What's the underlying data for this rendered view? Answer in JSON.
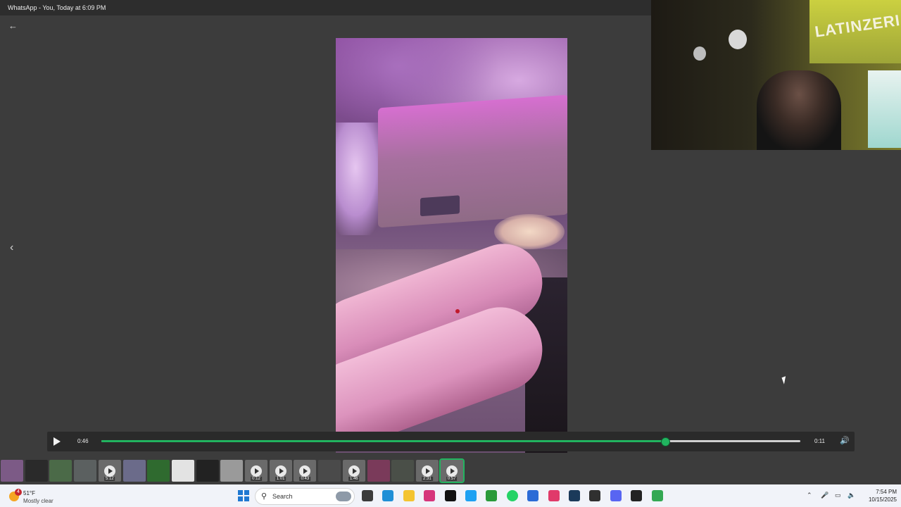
{
  "window": {
    "title": "WhatsApp - You, Today at 6:09 PM"
  },
  "player": {
    "current_time": "0:46",
    "remaining_time": "0:11",
    "progress": 0.807
  },
  "webcam": {
    "wall_text": "LATINZERIAN"
  },
  "thumbnails": [
    {
      "duration": "",
      "color": "#7c5a86",
      "type": "image"
    },
    {
      "duration": "",
      "color": "#2a2a2a",
      "type": "image"
    },
    {
      "duration": "",
      "color": "#4b6a48",
      "type": "image"
    },
    {
      "duration": "",
      "color": "#5b6060",
      "type": "image"
    },
    {
      "duration": "5:12",
      "color": "#6a6a6a",
      "type": "video"
    },
    {
      "duration": "",
      "color": "#6b6b8a",
      "type": "image"
    },
    {
      "duration": "",
      "color": "#2f6a2f",
      "type": "image"
    },
    {
      "duration": "",
      "color": "#e3e3e3",
      "type": "image"
    },
    {
      "duration": "",
      "color": "#222222",
      "type": "image"
    },
    {
      "duration": "",
      "color": "#9a9a9a",
      "type": "image"
    },
    {
      "duration": "0:12",
      "color": "#6a6a6a",
      "type": "video"
    },
    {
      "duration": "1:01",
      "color": "#6a6a6a",
      "type": "video"
    },
    {
      "duration": "0:43",
      "color": "#6a6a6a",
      "type": "video"
    },
    {
      "duration": "",
      "color": "#4a4a4a",
      "type": "image"
    },
    {
      "duration": "1:46",
      "color": "#6a6a6a",
      "type": "video"
    },
    {
      "duration": "",
      "color": "#7a3a5a",
      "type": "image"
    },
    {
      "duration": "",
      "color": "#4a4f48",
      "type": "image"
    },
    {
      "duration": "2:31",
      "color": "#6a6a6a",
      "type": "video"
    },
    {
      "duration": "0:57",
      "color": "#6a6a6a",
      "type": "video",
      "selected": true
    }
  ],
  "taskbar": {
    "weather": {
      "temp": "51°F",
      "condition": "Mostly clear",
      "notification_count": "4"
    },
    "search_placeholder": "Search",
    "clock": {
      "time": "7:54 PM",
      "date": "10/15/2025"
    },
    "pinned": [
      {
        "name": "task-view-icon",
        "color": "#3b3b3b"
      },
      {
        "name": "edge-icon",
        "color": "#1f8fd6"
      },
      {
        "name": "file-explorer-icon",
        "color": "#f4c430"
      },
      {
        "name": "instagram-icon",
        "color": "#d6357b"
      },
      {
        "name": "tiktok-icon",
        "color": "#111111"
      },
      {
        "name": "twitter-icon",
        "color": "#1da1f2"
      },
      {
        "name": "xbox-icon",
        "color": "#2a9a3a"
      },
      {
        "name": "whatsapp-icon",
        "color": "#25d366"
      },
      {
        "name": "store-icon",
        "color": "#2b6bd6"
      },
      {
        "name": "capcut-icon",
        "color": "#e03a6a"
      },
      {
        "name": "steam-icon",
        "color": "#1b3a5a"
      },
      {
        "name": "obs-icon",
        "color": "#303030"
      },
      {
        "name": "discord-icon",
        "color": "#5865f2"
      },
      {
        "name": "github-icon",
        "color": "#222222"
      },
      {
        "name": "chrome-icon",
        "color": "#34a853"
      }
    ],
    "accent": "#21b45f"
  }
}
